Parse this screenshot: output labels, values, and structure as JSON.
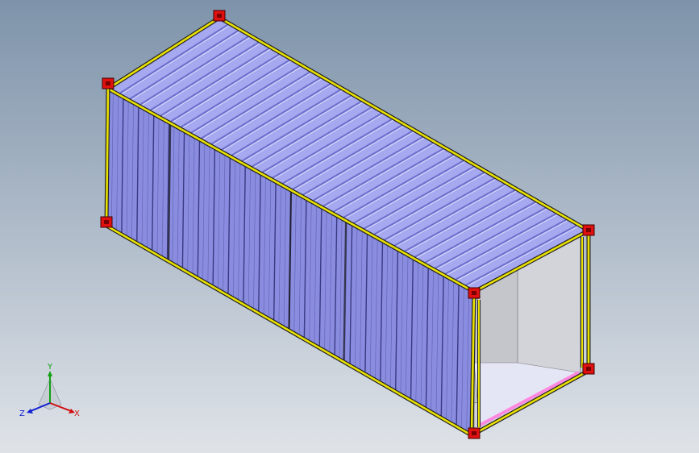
{
  "viewport": {
    "background_top": "#7e93aa",
    "background_bottom": "#dfe3e8"
  },
  "model": {
    "name": "shipping-container",
    "roof_color": "#a6a8f0",
    "roof_groove_color": "#5a5cc0",
    "side_color": "#8a8ce0",
    "side_rib_color": "#2a2c70",
    "frame_color": "#e8e000",
    "corner_casting_color": "#e01010",
    "interior_wall_color": "#d2d4da",
    "interior_floor_color": "#e4e6f6",
    "floor_edge_color": "#ff88e0"
  },
  "triad": {
    "x_label": "X",
    "y_label": "Y",
    "z_label": "Z",
    "x_color": "#d01010",
    "y_color": "#10a010",
    "z_color": "#1020d0"
  }
}
